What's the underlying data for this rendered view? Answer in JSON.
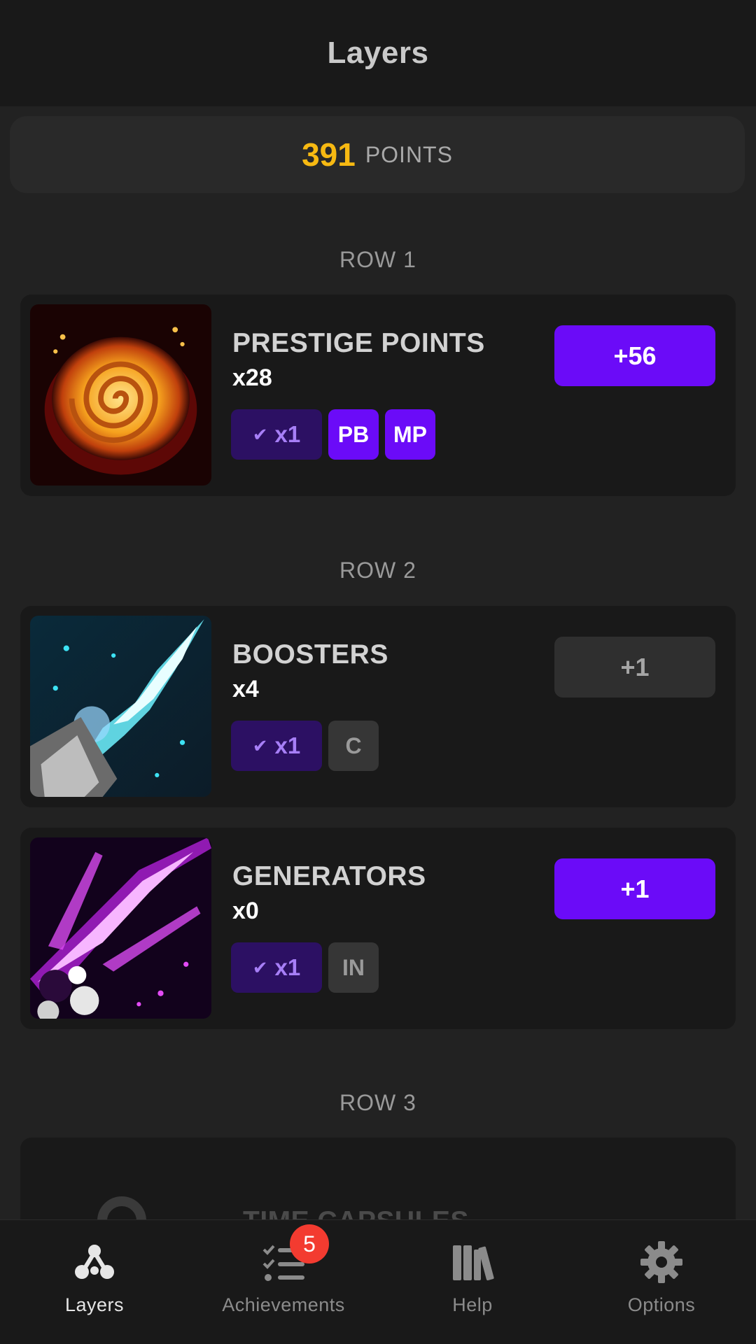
{
  "header": {
    "title": "Layers"
  },
  "points": {
    "value": "391",
    "label": "POINTS"
  },
  "rows": [
    {
      "label": "ROW 1"
    },
    {
      "label": "ROW 2"
    },
    {
      "label": "ROW 3"
    }
  ],
  "layers": [
    {
      "name": "PRESTIGE POINTS",
      "count": "x28",
      "multiplier": "x1",
      "chips": [
        "PB",
        "MP"
      ],
      "button": "+56",
      "image_icon": "glowing-spiral-icon"
    },
    {
      "name": "BOOSTERS",
      "count": "x4",
      "multiplier": "x1",
      "chips": [
        "C"
      ],
      "button": "+1",
      "image_icon": "cyan-lightning-icon"
    },
    {
      "name": "GENERATORS",
      "count": "x0",
      "multiplier": "x1",
      "chips": [
        "IN"
      ],
      "button": "+1",
      "image_icon": "magenta-lightning-icon"
    }
  ],
  "partial_layer": {
    "name": "TIME CAPSULES"
  },
  "tabs": [
    {
      "label": "Layers",
      "icon": "layers-icon"
    },
    {
      "label": "Achievements",
      "icon": "checklist-icon",
      "badge": "5"
    },
    {
      "label": "Help",
      "icon": "books-icon"
    },
    {
      "label": "Options",
      "icon": "gear-icon"
    }
  ],
  "colors": {
    "accent": "#6b0bf8",
    "points": "#f7b912",
    "badge": "#f33b30",
    "background": "#222222",
    "card": "#191919"
  }
}
